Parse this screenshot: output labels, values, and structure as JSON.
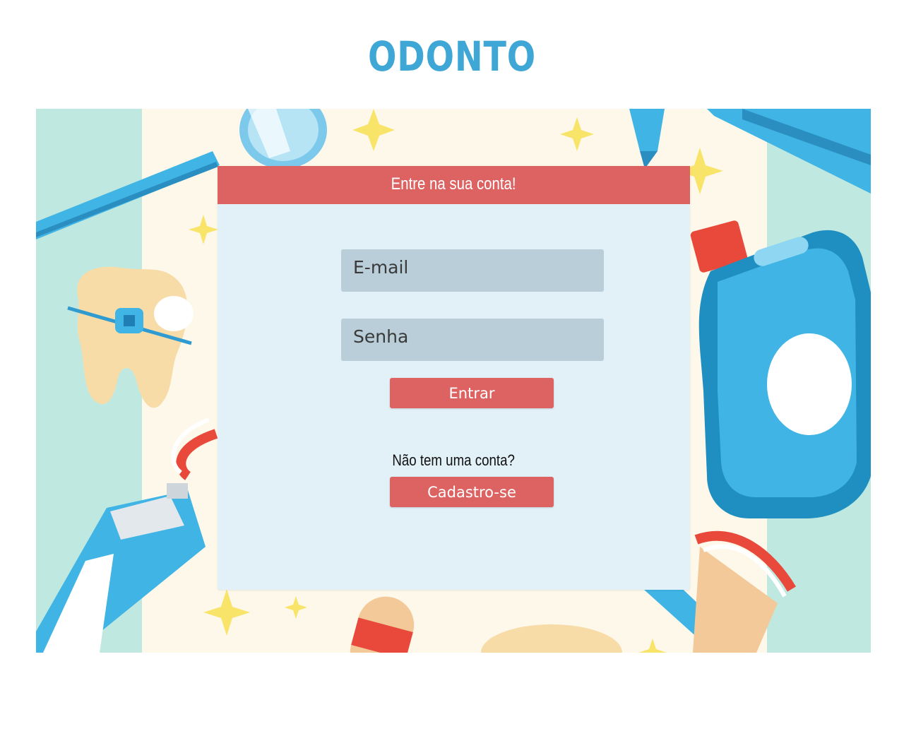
{
  "header": {
    "brand": "ODONTO"
  },
  "login_card": {
    "title": "Entre na sua conta!",
    "email_placeholder": "E-mail",
    "password_placeholder": "Senha",
    "login_button": "Entrar",
    "signup_prompt": "Não tem uma conta?",
    "signup_button": "Cadastro-se"
  },
  "background": {
    "illustration": "dental-tools-illustration",
    "icons": [
      "toothbrush-icon",
      "magnifier-icon",
      "tooth-with-braces-icon",
      "mouthwash-bottle-icon",
      "toothpaste-tube-icon",
      "dental-syringe-icon",
      "sparkle-icon"
    ]
  },
  "colors": {
    "brand": "#3fa7d6",
    "accent": "#dd6363",
    "card_background": "#e2f0f8",
    "input_background": "#b9ced8"
  }
}
